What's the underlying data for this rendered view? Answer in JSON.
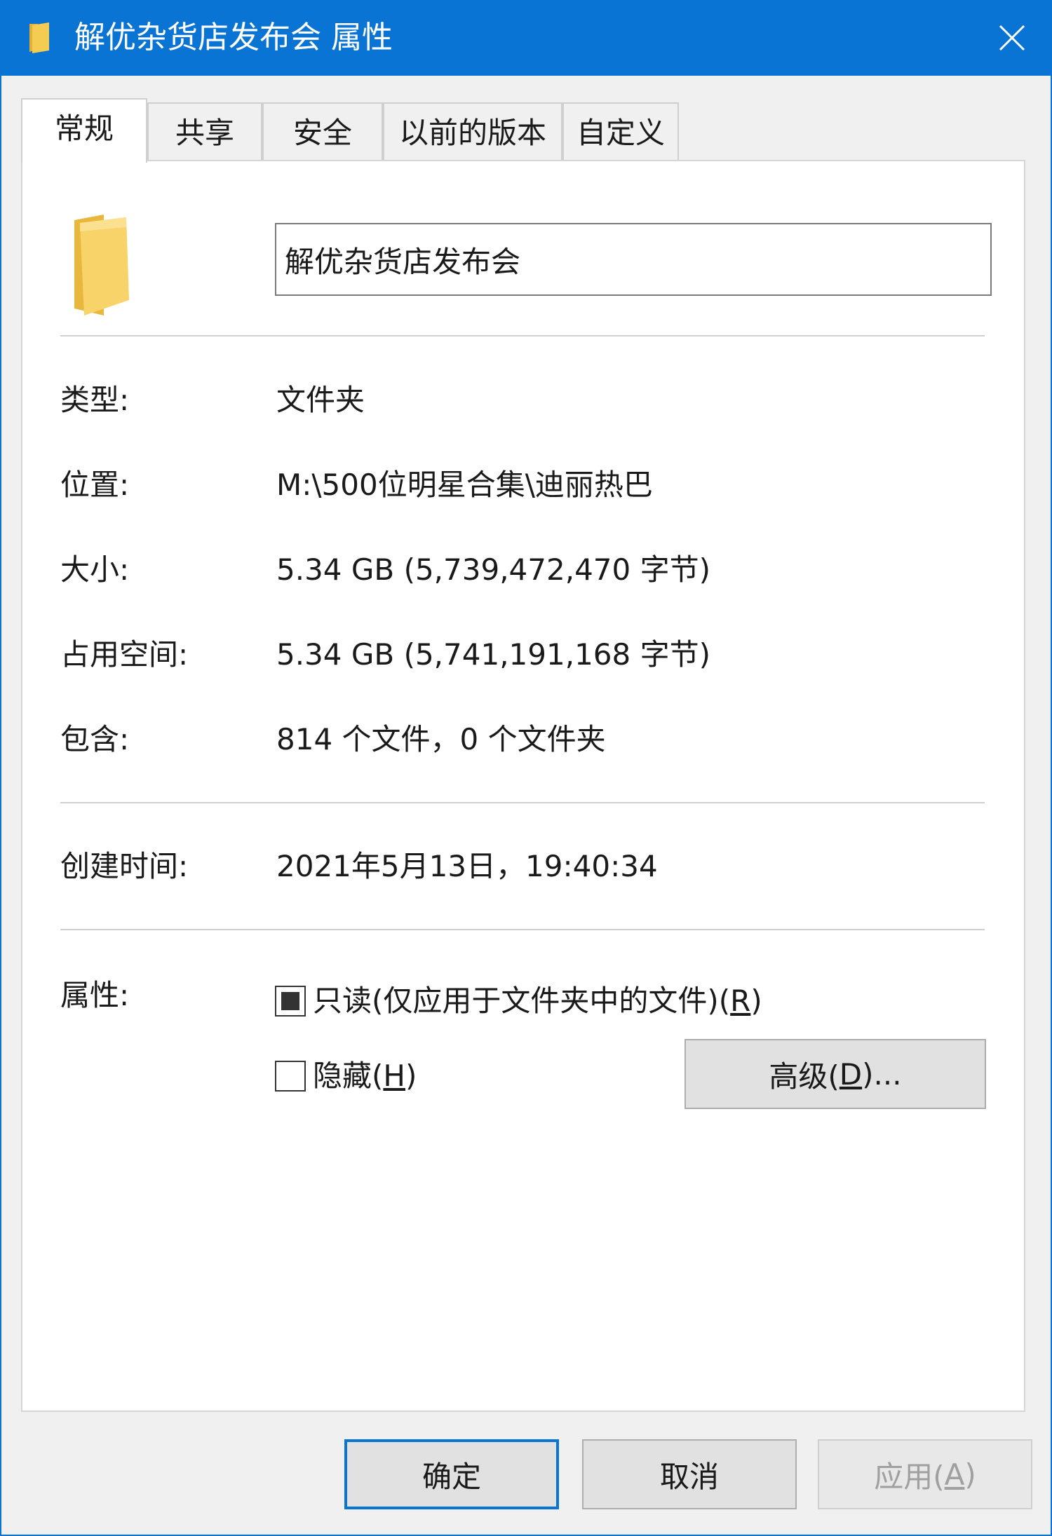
{
  "window": {
    "title": "解优杂货店发布会 属性"
  },
  "tabs": [
    {
      "label": "常规"
    },
    {
      "label": "共享"
    },
    {
      "label": "安全"
    },
    {
      "label": "以前的版本"
    },
    {
      "label": "自定义"
    }
  ],
  "general": {
    "name_value": "解优杂货店发布会",
    "type_label": "类型:",
    "type_value": "文件夹",
    "location_label": "位置:",
    "location_value": "M:\\500位明星合集\\迪丽热巴",
    "size_label": "大小:",
    "size_value": "5.34 GB (5,739,472,470 字节)",
    "disk_label": "占用空间:",
    "disk_value": "5.34 GB (5,741,191,168 字节)",
    "contains_label": "包含:",
    "contains_value": "814 个文件，0 个文件夹",
    "created_label": "创建时间:",
    "created_value": "2021年5月13日，19:40:34",
    "attributes_label": "属性:"
  },
  "attributes": {
    "readonly_text": "只读(仅应用于文件夹中的文件)(",
    "readonly_key": "R",
    "readonly_close": ")",
    "hidden_text": "隐藏(",
    "hidden_key": "H",
    "hidden_close": ")",
    "advanced_text": "高级(",
    "advanced_key": "D",
    "advanced_close": ")..."
  },
  "footer": {
    "ok_label": "确定",
    "cancel_label": "取消",
    "apply_text": "应用(",
    "apply_key": "A",
    "apply_close": ")"
  },
  "colors": {
    "titlebar": "#0a74d4",
    "folder": "#f0c94c"
  },
  "icons": {
    "title_folder": "folder-icon",
    "close": "close-icon",
    "large_folder": "folder-icon"
  }
}
